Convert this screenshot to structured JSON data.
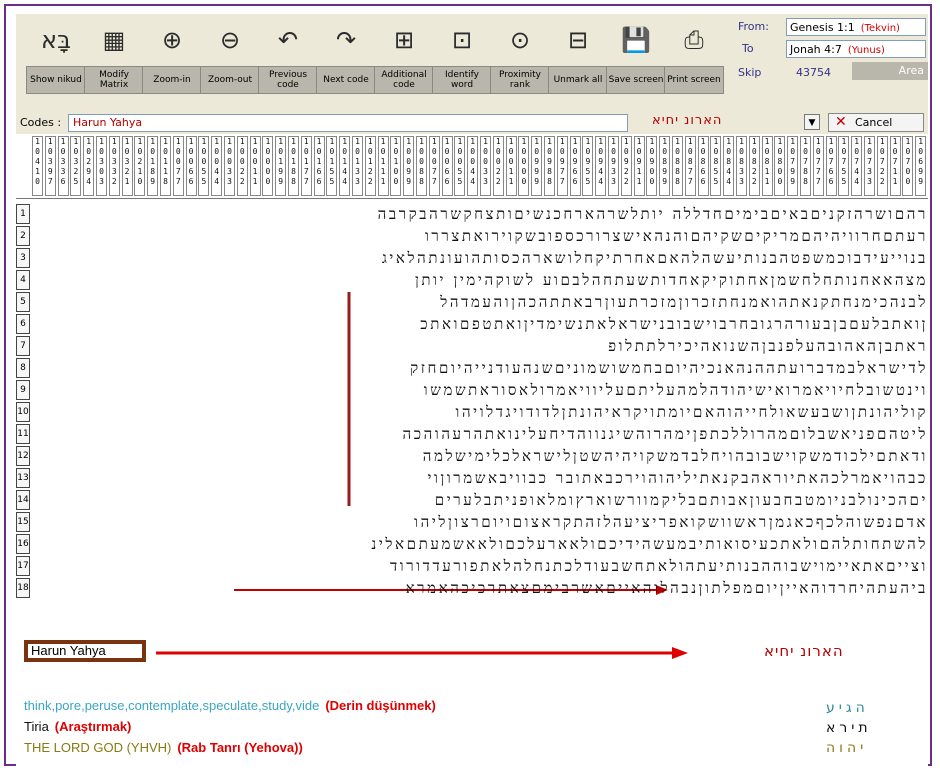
{
  "toolbar": {
    "buttons": [
      {
        "label": "Show nikud",
        "icon": "letters-icon",
        "glyph": "בָּא"
      },
      {
        "label": "Modify Matrix",
        "icon": "matrix-icon",
        "glyph": "▦"
      },
      {
        "label": "Zoom-in",
        "icon": "zoom-in-icon",
        "glyph": "⊕"
      },
      {
        "label": "Zoom-out",
        "icon": "zoom-out-icon",
        "glyph": "⊖"
      },
      {
        "label": "Previous code",
        "icon": "previous-code-icon",
        "glyph": "↶"
      },
      {
        "label": "Next code",
        "icon": "next-code-icon",
        "glyph": "↷"
      },
      {
        "label": "Additional code",
        "icon": "additional-code-icon",
        "glyph": "⊞"
      },
      {
        "label": "Identify word",
        "icon": "identify-word-icon",
        "glyph": "⊡"
      },
      {
        "label": "Proximity rank",
        "icon": "proximity-rank-icon",
        "glyph": "⊙"
      },
      {
        "label": "Unmark all",
        "icon": "unmark-all-icon",
        "glyph": "⊟"
      },
      {
        "label": "Save screen",
        "icon": "save-icon",
        "glyph": "💾"
      },
      {
        "label": "Print screen",
        "icon": "print-icon",
        "glyph": "⎙"
      }
    ]
  },
  "range": {
    "from_label": "From:",
    "from_value": "Genesis 1:1",
    "from_note": "(Tekvin)",
    "to_label": "To",
    "to_value": "Jonah 4:7",
    "to_note": "(Yunus)",
    "skip_label": "Skip",
    "skip_value": "43754",
    "area_label": "Area"
  },
  "codes": {
    "label": "Codes :",
    "value": "Harun Yahya",
    "code_letters": "הארונ יחיא",
    "cancel_label": "Cancel"
  },
  "ruler": {
    "columns": [
      "1\n0\n4\n1\n0",
      "1\n0\n3\n9\n7",
      "1\n0\n3\n3\n6",
      "1\n0\n3\n2\n5",
      "1\n0\n2\n9\n4",
      "1\n0\n3\n0\n3",
      "1\n0\n3\n3\n2",
      "1\n0\n3\n2\n1",
      "1\n0\n2\n1\n0",
      "1\n0\n1\n8\n9",
      "1\n0\n1\n1\n8",
      "1\n0\n0\n7\n7",
      "1\n0\n0\n6\n6",
      "1\n0\n0\n5\n5",
      "1\n0\n0\n4\n4",
      "1\n0\n0\n3\n3",
      "1\n0\n0\n2\n2",
      "1\n0\n0\n1\n1",
      "1\n0\n0\n0\n0",
      "1\n0\n1\n9\n9",
      "1\n0\n1\n8\n8",
      "1\n0\n1\n7\n7",
      "1\n0\n1\n6\n6",
      "1\n0\n1\n5\n5",
      "1\n0\n1\n4\n4",
      "1\n0\n1\n3\n3",
      "1\n0\n1\n2\n2",
      "1\n0\n1\n1\n1",
      "1\n0\n1\n0\n0",
      "1\n0\n0\n9\n9",
      "1\n0\n0\n8\n8",
      "1\n0\n0\n7\n7",
      "1\n0\n0\n6\n6",
      "1\n0\n0\n5\n5",
      "1\n0\n0\n4\n4",
      "1\n0\n0\n3\n3",
      "1\n0\n0\n2\n2",
      "1\n0\n0\n1\n1",
      "1\n0\n0\n0\n0",
      "1\n0\n9\n9\n9",
      "1\n0\n9\n8\n8",
      "1\n0\n9\n7\n7",
      "1\n0\n9\n6\n6",
      "1\n0\n9\n5\n5",
      "1\n0\n9\n4\n4",
      "1\n0\n9\n3\n3",
      "1\n0\n9\n2\n2",
      "1\n0\n9\n1\n1",
      "1\n0\n9\n0\n0",
      "1\n0\n8\n9\n9",
      "1\n0\n8\n8\n8",
      "1\n0\n8\n7\n7",
      "1\n0\n8\n6\n6",
      "1\n0\n8\n5\n5",
      "1\n0\n8\n4\n4",
      "1\n0\n8\n3\n3",
      "1\n0\n8\n2\n2",
      "1\n0\n8\n1\n1",
      "1\n0\n8\n0\n0",
      "1\n0\n7\n9\n9",
      "1\n0\n7\n8\n8",
      "1\n0\n7\n7\n7",
      "1\n0\n7\n6\n6",
      "1\n0\n7\n5\n5",
      "1\n0\n7\n4\n4",
      "1\n0\n7\n3\n3",
      "1\n0\n7\n2\n2",
      "1\n0\n7\n1\n1",
      "1\n0\n7\n0\n0",
      "1\n0\n6\n9\n9"
    ]
  },
  "grid": {
    "rows": [
      {
        "num": "1",
        "text": "רהםושרהזקניםבאיםבימיםחדללה יותלשרהארחכנשיםותצחקשרהבקרבה"
      },
      {
        "num": "2",
        "text": "רעתםחרוויהיהםמריקיםשקיהםוהנהאישצרורכספובשקוירואתצררו"
      },
      {
        "num": "3",
        "text": "בנוייעידבוכמשפטהבנותיעשהלהאםאחרתיקחלושארהכסותהועונתהלאיג"
      },
      {
        "num": "4",
        "text": "מצהאאחנותחלחשמןאחתוקיקאחדותשעתחהלבםוע לשוקהימין יותן"
      },
      {
        "num": "5",
        "text": "לבנהכימנחתקנאתהואמנחתזכרוןמזכרתעוןרבאתתהכהןוהעמדהל"
      },
      {
        "num": "6",
        "text": "ןואתבלעםבןבעורהרגובחרבוישבובנישראלאתנשימדיןואתטפםואתכ"
      },
      {
        "num": "7",
        "text": "ראתבןהאהובהעלפנבןהשנואהיכירלתתלופ"
      },
      {
        "num": "8",
        "text": "לדישראלבמדברועתההנהאנכיהיוםבחמשושמוניםשנהעודנייהיוםחזק"
      },
      {
        "num": "9",
        "text": "וינטשובלחיויאמרואישיהודהלמהעליתםעליוויאמרולאסוראתשמשו"
      },
      {
        "num": "10",
        "text": "קוליהונתןושבעשאולחייהוהאםיומתויקראיהונתןלדודויגדלויהו"
      },
      {
        "num": "11",
        "text": "ליטהםפניאשבלוםמהרוללכתפןימהרוהשיגנווהדיחעלינואתהרעהוהכה"
      },
      {
        "num": "12",
        "text": "ודאתםילכודמשקוישבובהויחלבדמשקויהיהשטןלישראלכלימישלמה"
      },
      {
        "num": "13",
        "text": "כבהויאמרלכהאתיוראהבקנאתיליהוהוירכבאתובר כבוויבאשמרוןוי"
      },
      {
        "num": "14",
        "text": "יםהכינולבניומטבחבעוןאבותםבליקמוורשוארץומלאופניתבלערים"
      },
      {
        "num": "15",
        "text": "אדםנפשוהלכףכאגמןראשוושקואפריציעהלזהתקראצוםויוםרצוןליהו"
      },
      {
        "num": "16",
        "text": "להשתחותלהםולאתכעיסואותיבמעשהידיכםולאארעלכםולאאשמעתםאלינ"
      },
      {
        "num": "17",
        "text": "וצייםאתאיימוישבוההבנותיעתהולאתחשבעודלכתנחלהלאתפורעדדורוד"
      },
      {
        "num": "18",
        "text": "ביהעתהיחרדוהאייןיוםמפלתוןנבהלוהאייםאשרבימםצאתרכיכהאמרא"
      }
    ],
    "code_name": "Harun Yahya",
    "code_circles": "הארונ יחיא"
  },
  "legend": {
    "items": [
      {
        "english": "think,pore,peruse,contemplate,speculate,study,vide",
        "turkish": "(Derin düşünmek)",
        "color": "#3aa6c0"
      },
      {
        "english": "Tiria",
        "turkish": "(Araştırmak)",
        "color": "#111111"
      },
      {
        "english": "THE LORD GOD (YHVH)",
        "turkish": "(Rab Tanrı (Yehova))",
        "color": "#8a7a10"
      }
    ],
    "symbols": [
      "הגיע",
      "תירא",
      "יהוה"
    ]
  },
  "colors": {
    "accent_red": "#d40000",
    "code_line": "#9b1b1b",
    "frame": "#6a2d8a",
    "toolbar_bg": "#ece9d8"
  }
}
